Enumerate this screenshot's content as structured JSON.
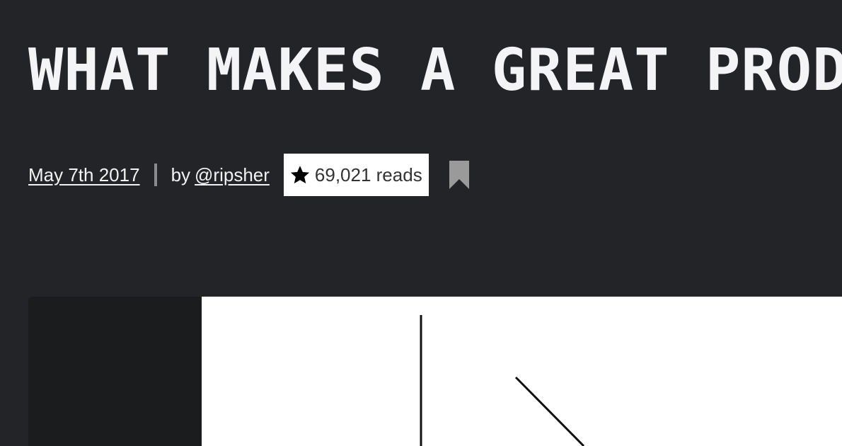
{
  "article": {
    "title": "WHAT MAKES A GREAT PROD",
    "date": "May 7th 2017",
    "by_label": "by",
    "author": "@ripsher",
    "reads": "69,021 reads"
  },
  "icons": {
    "star": "star-icon",
    "bookmark": "bookmark-icon"
  },
  "colors": {
    "background": "#232428",
    "title": "#f4f4f6",
    "reads_badge": "#ffffff",
    "bookmark": "#9a9a9a"
  }
}
